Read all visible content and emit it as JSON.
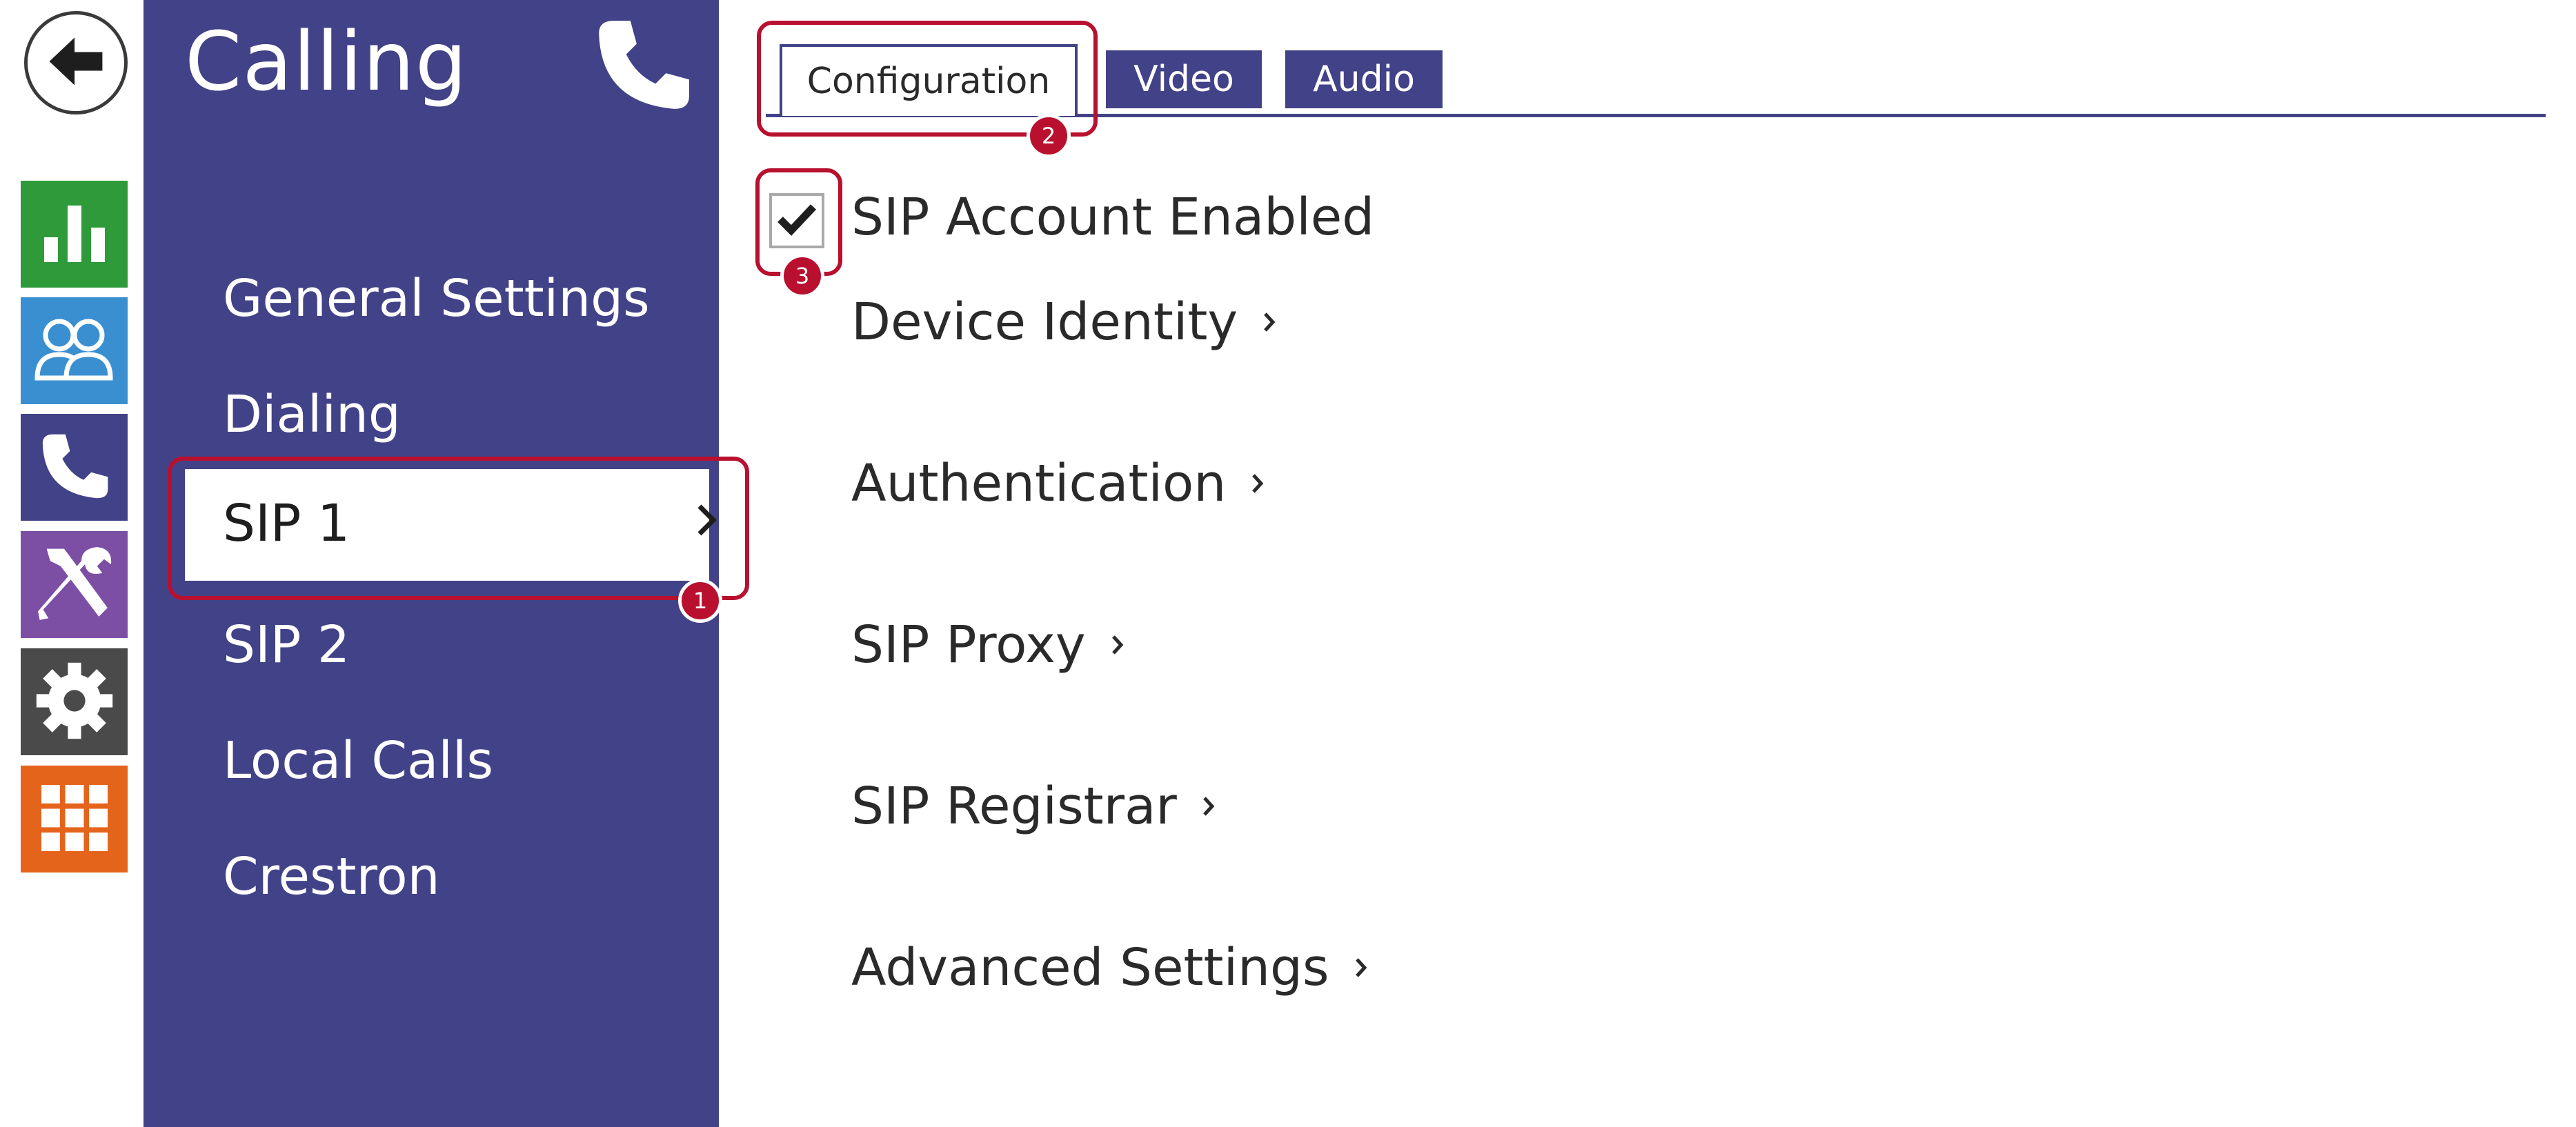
{
  "back_button": {
    "icon": "arrow-left-icon"
  },
  "rail": {
    "items": [
      {
        "name": "status",
        "icon": "bar-chart-icon",
        "color": "#2e9a3a"
      },
      {
        "name": "directory",
        "icon": "users-icon",
        "color": "#3a8fd1"
      },
      {
        "name": "calling",
        "icon": "phone-icon",
        "color": "#424288"
      },
      {
        "name": "services",
        "icon": "tools-icon",
        "color": "#7c4fa5"
      },
      {
        "name": "hardware",
        "icon": "gear-icon",
        "color": "#4a4a4a"
      },
      {
        "name": "system",
        "icon": "grid-icon",
        "color": "#e4641c"
      }
    ]
  },
  "sidebar": {
    "title": "Calling",
    "title_icon": "phone-icon",
    "items": [
      {
        "label": "General Settings"
      },
      {
        "label": "Dialing"
      },
      {
        "label": "SIP 1",
        "selected": true
      },
      {
        "label": "SIP 2"
      },
      {
        "label": "Local Calls"
      },
      {
        "label": "Crestron"
      }
    ]
  },
  "tabs": [
    {
      "label": "Configuration",
      "active": true
    },
    {
      "label": "Video"
    },
    {
      "label": "Audio"
    }
  ],
  "main": {
    "checkbox": {
      "label": "SIP Account Enabled",
      "checked": true
    },
    "sections": [
      {
        "label": "Device Identity"
      },
      {
        "label": "Authentication"
      },
      {
        "label": "SIP Proxy"
      },
      {
        "label": "SIP Registrar"
      },
      {
        "label": "Advanced Settings"
      }
    ]
  },
  "annotations": [
    {
      "number": "1"
    },
    {
      "number": "2"
    },
    {
      "number": "3"
    }
  ],
  "colors": {
    "brand": "#424288",
    "annotation": "#b8102e"
  }
}
